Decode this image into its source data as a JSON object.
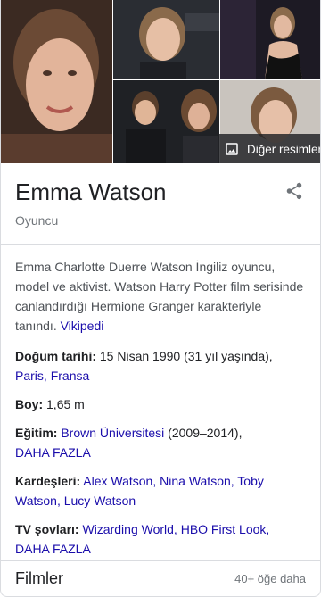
{
  "photos": {
    "more_label": "Diğer resimler",
    "more_icon": "image-gallery-icon"
  },
  "header": {
    "title": "Emma Watson",
    "subtitle": "Oyuncu",
    "share_icon": "share-icon"
  },
  "description": {
    "text": "Emma Charlotte Duerre Watson İngiliz oyuncu, model ve aktivist. Watson Harry Potter film serisinde canlandırdığı Hermione Granger karakteriyle tanındı.",
    "source_link": "Vikipedi"
  },
  "facts": {
    "birth": {
      "label": "Doğum tarihi:",
      "value": "15 Nisan 1990 (31 yıl yaşında),",
      "link1": "Paris,",
      "link2": "Fransa"
    },
    "height": {
      "label": "Boy:",
      "value": "1,65 m"
    },
    "education": {
      "label": "Eğitim:",
      "link": "Brown Üniversitesi",
      "value": "(2009–2014),",
      "more": "DAHA FAZLA"
    },
    "siblings": {
      "label": "Kardeşleri:",
      "links": [
        "Alex Watson,",
        "Nina Watson,",
        "Toby Watson,",
        "Lucy Watson"
      ]
    },
    "tv": {
      "label": "TV şovları:",
      "links": [
        "Wizarding World,",
        "HBO First Look,"
      ],
      "more": "DAHA FAZLA"
    }
  },
  "films": {
    "title": "Filmler",
    "more": "40+ öğe daha"
  },
  "colors": {
    "link": "#1a0dab",
    "text": "#202124",
    "muted": "#70757a"
  }
}
